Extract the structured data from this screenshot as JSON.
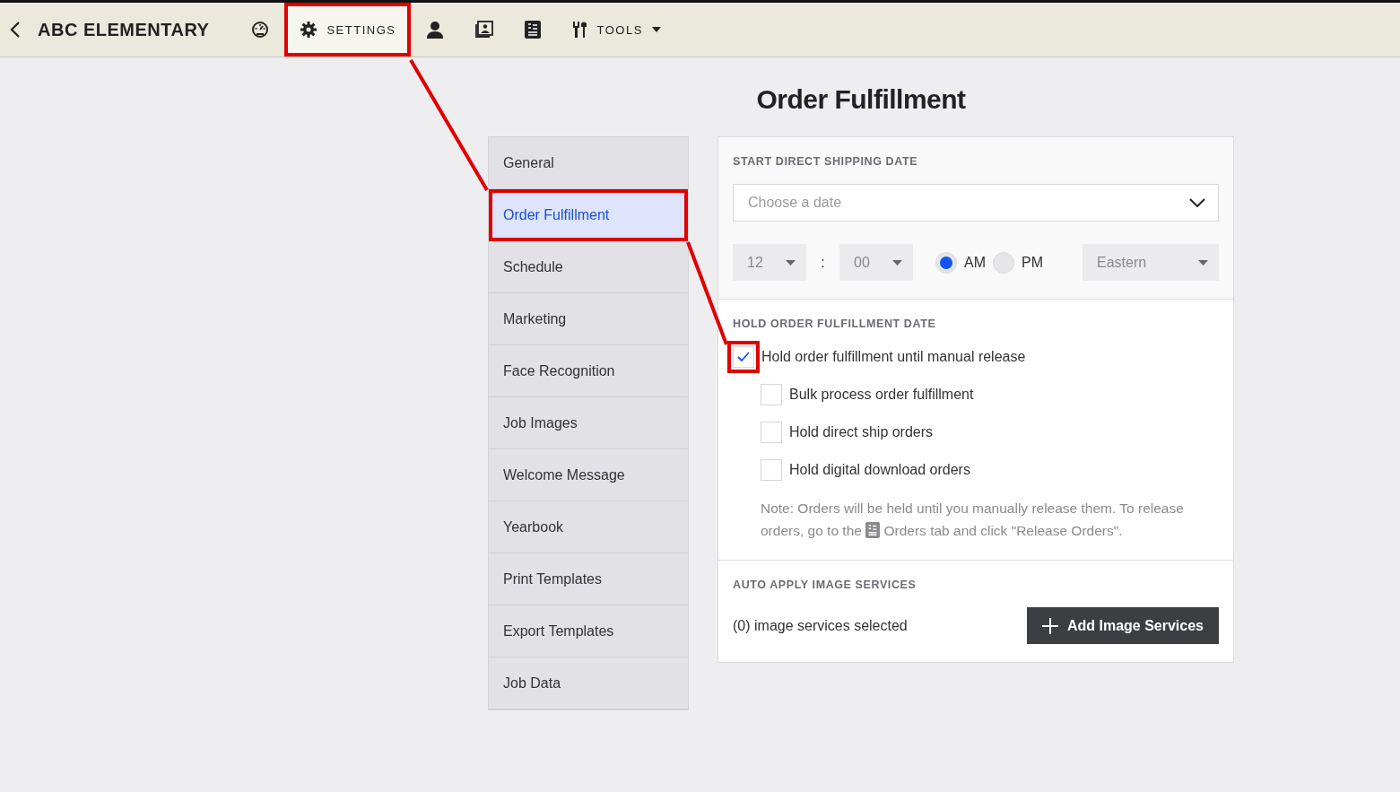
{
  "top_bar": {
    "title": "ABC ELEMENTARY",
    "nav": [
      {
        "kind": "icon",
        "selected": false,
        "highlighted": false
      },
      {
        "kind": "labeled",
        "label": "SETTINGS",
        "selected": true,
        "highlighted": true
      },
      {
        "kind": "icon",
        "selected": false,
        "highlighted": false
      },
      {
        "kind": "icon",
        "selected": false,
        "highlighted": false
      },
      {
        "kind": "icon",
        "selected": false,
        "highlighted": false
      },
      {
        "kind": "dropdown",
        "label": "TOOLS",
        "selected": false,
        "highlighted": false
      }
    ]
  },
  "page_title": "Order Fulfillment",
  "sidebar": {
    "items": [
      {
        "label": "General",
        "selected": false,
        "highlighted": false
      },
      {
        "label": "Order Fulfillment",
        "selected": true,
        "highlighted": true
      },
      {
        "label": "Schedule",
        "selected": false,
        "highlighted": false
      },
      {
        "label": "Marketing",
        "selected": false,
        "highlighted": false
      },
      {
        "label": "Face Recognition",
        "selected": false,
        "highlighted": false
      },
      {
        "label": "Job Images",
        "selected": false,
        "highlighted": false
      },
      {
        "label": "Welcome Message",
        "selected": false,
        "highlighted": false
      },
      {
        "label": "Yearbook",
        "selected": false,
        "highlighted": false
      },
      {
        "label": "Print Templates",
        "selected": false,
        "highlighted": false
      },
      {
        "label": "Export Templates",
        "selected": false,
        "highlighted": false
      },
      {
        "label": "Job Data",
        "selected": false,
        "highlighted": false
      }
    ]
  },
  "shipping": {
    "heading": "START DIRECT SHIPPING DATE",
    "date": {
      "placeholder": "Choose a date"
    },
    "hour": "12",
    "separator": ":",
    "minute": "00",
    "meridiem": [
      {
        "label": "AM",
        "selected": true
      },
      {
        "label": "PM",
        "selected": false
      }
    ],
    "timezone": "Eastern"
  },
  "hold": {
    "heading": "HOLD ORDER FULFILLMENT DATE",
    "options": [
      {
        "kind": "main",
        "label": "Hold order fulfillment until manual release",
        "checked": true,
        "highlighted": true
      },
      {
        "kind": "sub",
        "label": "Bulk process order fulfillment",
        "checked": false,
        "highlighted": false
      },
      {
        "kind": "sub",
        "label": "Hold direct ship orders",
        "checked": false,
        "highlighted": false
      },
      {
        "kind": "sub",
        "label": "Hold digital download orders",
        "checked": false,
        "highlighted": false
      }
    ],
    "note_before": "Note: Orders will be held until you manually release them. To release orders, go to the",
    "note_after": "Orders tab and click \"Release Orders\"."
  },
  "image_services": {
    "heading": "AUTO APPLY IMAGE SERVICES",
    "status": "(0) image services selected",
    "button": "Add Image Services"
  }
}
